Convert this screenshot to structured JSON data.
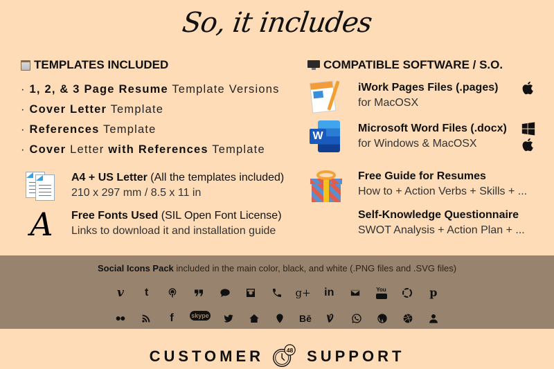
{
  "title": "So, it includes",
  "templates": {
    "heading": "TEMPLATES INCLUDED",
    "heading_icon": "notepad-icon",
    "bullets": [
      {
        "bold": "1, 2, & 3 Page Resume",
        "rest": " Template Versions"
      },
      {
        "bold": "Cover Letter",
        "rest": " Template"
      },
      {
        "bold": "References",
        "rest": " Template"
      },
      {
        "bold": "Cover",
        "mid": " Letter ",
        "bold2": "with References",
        "rest": " Template"
      }
    ],
    "bullet_marker": "·"
  },
  "features_left": [
    {
      "icon": "documents-icon",
      "title": "A4 + US Letter",
      "title_rest": " (All the templates included)",
      "subtitle": "210 x 297 mm / 8.5 x 11 in"
    },
    {
      "icon": "font-icon",
      "icon_glyph": "A",
      "title": "Free Fonts Used",
      "title_rest": " (SIL Open Font License)",
      "subtitle": "Links to download it and installation guide"
    }
  ],
  "software": {
    "heading": "COMPATIBLE SOFTWARE / S.O.",
    "heading_icon": "monitor-icon",
    "items": [
      {
        "icon": "pages-app-icon",
        "title": "iWork Pages Files (.pages)",
        "subtitle": "for MacOSX",
        "os": [
          "apple-icon"
        ]
      },
      {
        "icon": "word-app-icon",
        "icon_letter": "W",
        "title": "Microsoft Word Files (.docx)",
        "subtitle": "for Windows & MacOSX",
        "os": [
          "windows-icon",
          "apple-icon"
        ]
      }
    ]
  },
  "features_right": [
    {
      "icon": "gift-icon",
      "title": "Free Guide for Resumes",
      "subtitle": "How to + Action Verbs + Skills + ..."
    },
    {
      "title": "Self-Knowledge Questionnaire",
      "subtitle": "SWOT Analysis + Action Plan + ..."
    }
  ],
  "social": {
    "label_bold": "Social Icons Pack",
    "label_rest": " included in the main color, black, and white (.PNG files and .SVG files)",
    "row1": [
      "vimeo",
      "tumblr",
      "podcast",
      "quote",
      "chat",
      "instagram",
      "phone",
      "google-plus",
      "linkedin",
      "mail",
      "youtube",
      "picasa",
      "pinterest"
    ],
    "row2": [
      "flickr",
      "rss",
      "facebook",
      "skype",
      "twitter",
      "home",
      "location",
      "behance",
      "vine",
      "whatsapp",
      "wordpress",
      "dribbble",
      "user"
    ],
    "text_glyphs": {
      "tumblr": "t",
      "google-plus": "g+",
      "linkedin": "in",
      "facebook": "f",
      "behance": "Bē",
      "vimeo": "v",
      "skype": "skype",
      "pinterest": "p",
      "youtube": "You"
    }
  },
  "support": {
    "left": "CUSTOMER",
    "right": "SUPPORT",
    "clock_badge": "48"
  },
  "colors": {
    "background": "#fddcb7",
    "band": "#98846e",
    "text": "#111111"
  }
}
